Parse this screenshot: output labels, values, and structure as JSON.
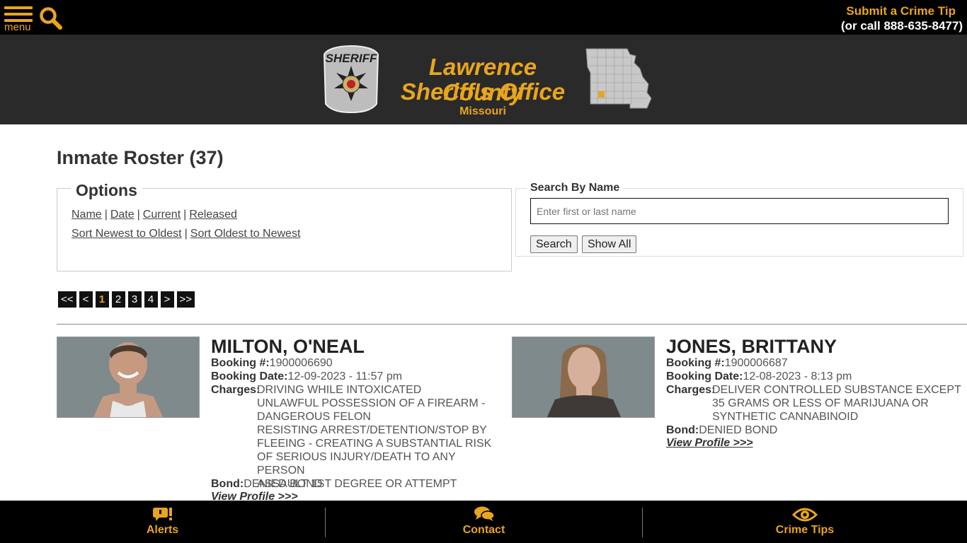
{
  "topbar": {
    "menu_label": "menu",
    "tip_link": "Submit a Crime Tip",
    "tip_call": "(or call 888-635-8477)"
  },
  "header": {
    "title_line1": "Lawrence County",
    "title_line2": "Sheriff's Office",
    "state": "Missouri"
  },
  "page": {
    "title": "Inmate Roster (37)"
  },
  "options": {
    "legend": "Options",
    "sort_links": [
      "Name",
      "Date",
      "Current",
      "Released"
    ],
    "order_links": [
      "Sort Newest to Oldest",
      "Sort Oldest to Newest"
    ]
  },
  "search": {
    "legend": "Search By Name",
    "placeholder": "Enter first or last name",
    "search_button": "Search",
    "show_all_button": "Show All"
  },
  "pager": {
    "first": "<<",
    "prev": "<",
    "pages": [
      "1",
      "2",
      "3",
      "4"
    ],
    "current": "1",
    "next": ">",
    "last": ">>"
  },
  "labels": {
    "booking_no": "Booking #:",
    "booking_date": "Booking Date:",
    "charges": "Charges:",
    "bond": "Bond:",
    "view_profile": "View Profile >>>"
  },
  "inmates": [
    {
      "name": "MILTON, O'NEAL",
      "booking_no": "1900006690",
      "booking_date": "12-09-2023 - 11:57 pm",
      "charges": [
        "DRIVING WHILE INTOXICATED",
        "UNLAWFUL POSSESSION OF A FIREARM - DANGEROUS FELON",
        "RESISTING ARREST/DETENTION/STOP BY FLEEING - CREATING A SUBSTANTIAL RISK OF SERIOUS INJURY/DEATH TO ANY PERSON",
        "ASSAULT 1ST DEGREE OR ATTEMPT"
      ],
      "bond": "DENIED BOND"
    },
    {
      "name": "JONES, BRITTANY",
      "booking_no": "1900006687",
      "booking_date": "12-08-2023 - 8:13 pm",
      "charges": [
        "DELIVER CONTROLLED SUBSTANCE EXCEPT 35 GRAMS OR LESS OF MARIJUANA OR SYNTHETIC CANNABINOID"
      ],
      "bond": "DENIED BOND"
    }
  ],
  "footer": {
    "alerts": "Alerts",
    "contact": "Contact",
    "crime_tips": "Crime Tips"
  },
  "colors": {
    "accent": "#e8a51e",
    "topbar_bg": "#000000",
    "header_bg": "#2a2a2a"
  }
}
